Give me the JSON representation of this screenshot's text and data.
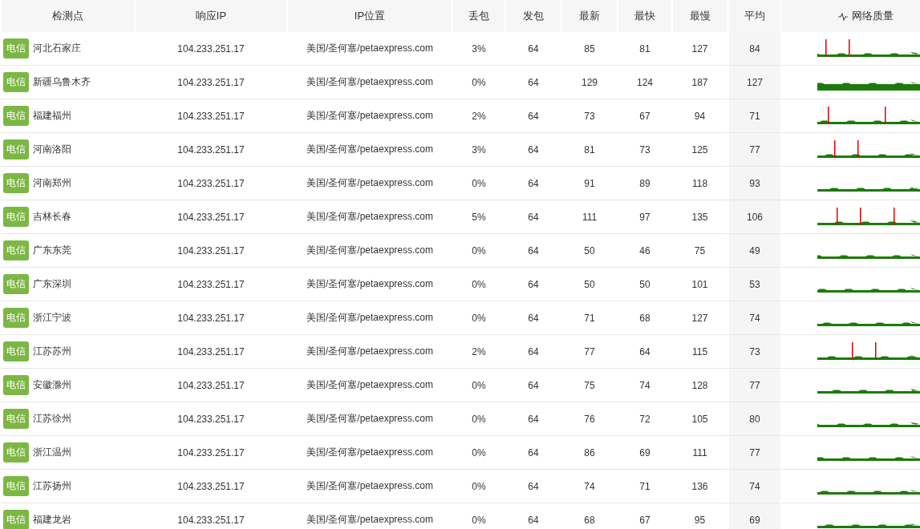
{
  "table": {
    "columns": [
      "检测点",
      "响应IP",
      "IP位置",
      "丢包",
      "发包",
      "最新",
      "最快",
      "最慢",
      "平均",
      "网络质量"
    ],
    "rows": [
      {
        "isp": "电信",
        "node": "河北石家庄",
        "ip": "104.233.251.17",
        "location": "美国/圣何塞/petaexpress.com",
        "loss": "3%",
        "sent": "64",
        "latest": "85",
        "fastest": "81",
        "slowest": "127",
        "average": "84"
      },
      {
        "isp": "电信",
        "node": "新疆乌鲁木齐",
        "ip": "104.233.251.17",
        "location": "美国/圣何塞/petaexpress.com",
        "loss": "0%",
        "sent": "64",
        "latest": "129",
        "fastest": "124",
        "slowest": "187",
        "average": "127"
      },
      {
        "isp": "电信",
        "node": "福建福州",
        "ip": "104.233.251.17",
        "location": "美国/圣何塞/petaexpress.com",
        "loss": "2%",
        "sent": "64",
        "latest": "73",
        "fastest": "67",
        "slowest": "94",
        "average": "71"
      },
      {
        "isp": "电信",
        "node": "河南洛阳",
        "ip": "104.233.251.17",
        "location": "美国/圣何塞/petaexpress.com",
        "loss": "3%",
        "sent": "64",
        "latest": "81",
        "fastest": "73",
        "slowest": "125",
        "average": "77"
      },
      {
        "isp": "电信",
        "node": "河南郑州",
        "ip": "104.233.251.17",
        "location": "美国/圣何塞/petaexpress.com",
        "loss": "0%",
        "sent": "64",
        "latest": "91",
        "fastest": "89",
        "slowest": "118",
        "average": "93"
      },
      {
        "isp": "电信",
        "node": "吉林长春",
        "ip": "104.233.251.17",
        "location": "美国/圣何塞/petaexpress.com",
        "loss": "5%",
        "sent": "64",
        "latest": "111",
        "fastest": "97",
        "slowest": "135",
        "average": "106"
      },
      {
        "isp": "电信",
        "node": "广东东莞",
        "ip": "104.233.251.17",
        "location": "美国/圣何塞/petaexpress.com",
        "loss": "0%",
        "sent": "64",
        "latest": "50",
        "fastest": "46",
        "slowest": "75",
        "average": "49"
      },
      {
        "isp": "电信",
        "node": "广东深圳",
        "ip": "104.233.251.17",
        "location": "美国/圣何塞/petaexpress.com",
        "loss": "0%",
        "sent": "64",
        "latest": "50",
        "fastest": "50",
        "slowest": "101",
        "average": "53"
      },
      {
        "isp": "电信",
        "node": "浙江宁波",
        "ip": "104.233.251.17",
        "location": "美国/圣何塞/petaexpress.com",
        "loss": "0%",
        "sent": "64",
        "latest": "71",
        "fastest": "68",
        "slowest": "127",
        "average": "74"
      },
      {
        "isp": "电信",
        "node": "江苏苏州",
        "ip": "104.233.251.17",
        "location": "美国/圣何塞/petaexpress.com",
        "loss": "2%",
        "sent": "64",
        "latest": "77",
        "fastest": "64",
        "slowest": "115",
        "average": "73"
      },
      {
        "isp": "电信",
        "node": "安徽滁州",
        "ip": "104.233.251.17",
        "location": "美国/圣何塞/petaexpress.com",
        "loss": "0%",
        "sent": "64",
        "latest": "75",
        "fastest": "74",
        "slowest": "128",
        "average": "77"
      },
      {
        "isp": "电信",
        "node": "江苏徐州",
        "ip": "104.233.251.17",
        "location": "美国/圣何塞/petaexpress.com",
        "loss": "0%",
        "sent": "64",
        "latest": "76",
        "fastest": "72",
        "slowest": "105",
        "average": "80"
      },
      {
        "isp": "电信",
        "node": "浙江温州",
        "ip": "104.233.251.17",
        "location": "美国/圣何塞/petaexpress.com",
        "loss": "0%",
        "sent": "64",
        "latest": "86",
        "fastest": "69",
        "slowest": "111",
        "average": "77"
      },
      {
        "isp": "电信",
        "node": "江苏扬州",
        "ip": "104.233.251.17",
        "location": "美国/圣何塞/petaexpress.com",
        "loss": "0%",
        "sent": "64",
        "latest": "74",
        "fastest": "71",
        "slowest": "136",
        "average": "74"
      },
      {
        "isp": "电信",
        "node": "福建龙岩",
        "ip": "104.233.251.17",
        "location": "美国/圣何塞/petaexpress.com",
        "loss": "0%",
        "sent": "64",
        "latest": "68",
        "fastest": "67",
        "slowest": "95",
        "average": "69"
      }
    ]
  }
}
